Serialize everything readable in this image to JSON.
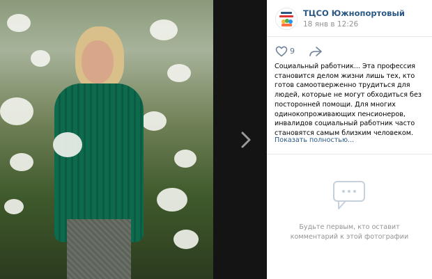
{
  "author": {
    "name": "ТЦСО Южнопортовый",
    "date": "18 янв в 12:26",
    "avatar_caption": "ТЦСО ЮЖНОПОРТОВЫЙ"
  },
  "likes": {
    "count": "9"
  },
  "post": {
    "text": "Социальный работник... Эта профессия становится делом жизни лишь тех, кто готов самоотверженно трудиться для людей, которые не могут обходиться без посторонней помощи. Для многих одинокопроживающих пенсионеров, инвалидов социальный работник часто становятся самым близким человеком.",
    "show_more": "Показать полностью..."
  },
  "comments": {
    "empty_text": "Будьте первым, кто оставит комментарий к этой фотографии"
  },
  "icons": {
    "next": "chevron-right-icon",
    "like": "heart-icon",
    "share": "share-arrow-icon",
    "comment": "comment-bubble-icon"
  },
  "colors": {
    "link": "#2a5885",
    "muted": "#939393",
    "viewer_bg": "#141414"
  }
}
